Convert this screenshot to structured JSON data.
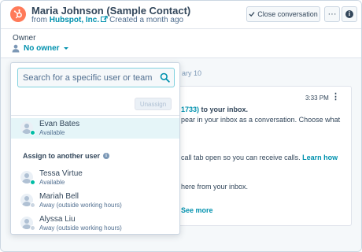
{
  "header": {
    "contact_name": "Maria Johnson (Sample Contact)",
    "from_prefix": "from",
    "company": "Hubspot, Inc.",
    "created": "Created a month ago",
    "close_label": "Close conversation",
    "more_label": "···"
  },
  "owner": {
    "label": "Owner",
    "value": "No owner"
  },
  "thread": {
    "date_fragment": "ary 10",
    "time": "3:33 PM",
    "lines": [
      {
        "prefix": "1733)",
        "suffix": " to your inbox."
      },
      {
        "text": "pear in your inbox as a conversation. Choose what"
      },
      {
        "text": "call tab open so you can receive calls. ",
        "link": "Learn how"
      },
      {
        "text": "here from your inbox."
      },
      {
        "link": "See more"
      }
    ]
  },
  "dropdown": {
    "search_placeholder": "Search for a specific user or team",
    "unassign_label": "Unassign",
    "current_user": {
      "name": "Evan Bates",
      "status": "Available"
    },
    "section_label": "Assign to another user",
    "users": [
      {
        "name": "Tessa Virtue",
        "status": "Available",
        "state": "available"
      },
      {
        "name": "Mariah Bell",
        "status": "Away (outside working hours)",
        "state": "away"
      },
      {
        "name": "Alyssa Liu",
        "status": "Away (outside working hours)",
        "state": "away"
      }
    ]
  },
  "colors": {
    "brand": "#ff7a59",
    "link": "#0091ae",
    "text": "#33475b",
    "available": "#00bda5",
    "selected_row": "#e5f5f8"
  },
  "icons": [
    "hubspot-logo-icon",
    "external-link-icon",
    "check-icon",
    "more-icon",
    "info-icon",
    "person-icon",
    "caret-down-icon",
    "search-icon",
    "avatar-icon"
  ]
}
